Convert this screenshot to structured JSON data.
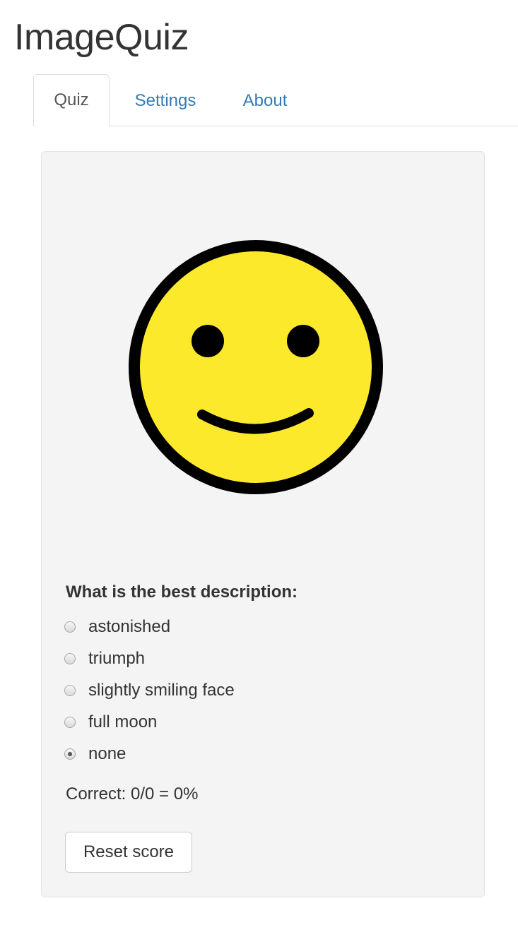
{
  "app": {
    "title": "ImageQuiz"
  },
  "tabs": [
    {
      "label": "Quiz",
      "active": true
    },
    {
      "label": "Settings",
      "active": false
    },
    {
      "label": "About",
      "active": false
    }
  ],
  "quiz": {
    "image": {
      "subject": "slightly-smiling-face-icon",
      "face_color": "#FDE92B",
      "outline_color": "#000000"
    },
    "question": "What is the best description:",
    "options": [
      {
        "label": "astonished",
        "selected": false
      },
      {
        "label": "triumph",
        "selected": false
      },
      {
        "label": "slightly smiling face",
        "selected": false
      },
      {
        "label": "full moon",
        "selected": false
      },
      {
        "label": "none",
        "selected": true
      }
    ],
    "score_text": "Correct: 0/0 = 0%",
    "reset_label": "Reset score"
  },
  "colors": {
    "link": "#337ab7",
    "text": "#333333",
    "panel_bg": "#f4f4f4",
    "border": "#dddddd"
  }
}
